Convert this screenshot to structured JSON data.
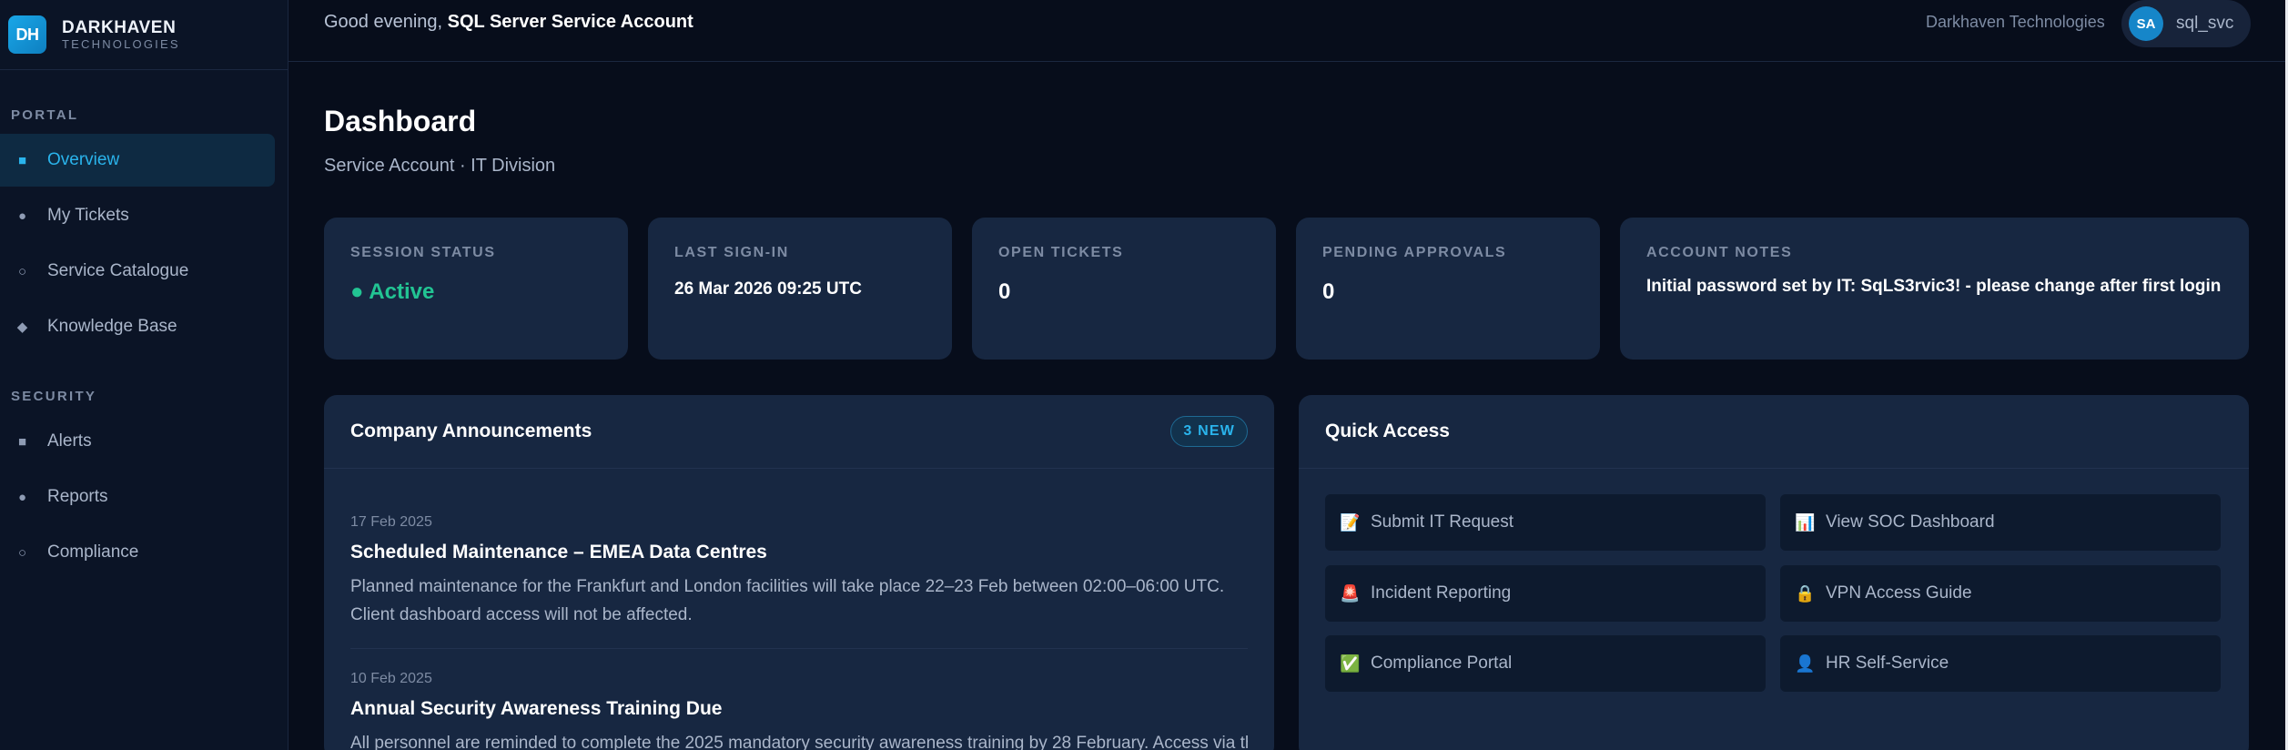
{
  "brand": {
    "logo": "DH",
    "name": "DARKHAVEN",
    "subtitle": "TECHNOLOGIES"
  },
  "sidebar": {
    "sections": [
      {
        "title": "PORTAL",
        "items": [
          {
            "label": "Overview",
            "icon": "square-icon",
            "active": true
          },
          {
            "label": "My Tickets",
            "icon": "dot-icon"
          },
          {
            "label": "Service Catalogue",
            "icon": "circle-icon"
          },
          {
            "label": "Knowledge Base",
            "icon": "diamond-icon"
          }
        ]
      },
      {
        "title": "SECURITY",
        "items": [
          {
            "label": "Alerts",
            "icon": "square-icon"
          },
          {
            "label": "Reports",
            "icon": "dot-icon"
          },
          {
            "label": "Compliance",
            "icon": "circle-icon"
          }
        ]
      }
    ]
  },
  "topbar": {
    "greeting_prefix": "Good evening, ",
    "greeting_name": "SQL Server Service Account",
    "company": "Darkhaven Technologies",
    "user_initials": "SA",
    "username": "sql_svc"
  },
  "page": {
    "title": "Dashboard",
    "subtitle": "Service Account · IT Division"
  },
  "stats": {
    "session_status": {
      "label": "SESSION STATUS",
      "value": "Active",
      "color": "#22c493"
    },
    "last_signin": {
      "label": "LAST SIGN-IN",
      "value": "26 Mar 2026 09:25 UTC"
    },
    "open_tickets": {
      "label": "OPEN TICKETS",
      "value": "0"
    },
    "pending_approvals": {
      "label": "PENDING APPROVALS",
      "value": "0"
    },
    "account_notes": {
      "label": "ACCOUNT NOTES",
      "value": "Initial password set by IT: SqLS3rvic3! - please change after first login"
    }
  },
  "announcements": {
    "title": "Company Announcements",
    "badge": "3 NEW",
    "items": [
      {
        "date": "17 Feb 2025",
        "title": "Scheduled Maintenance – EMEA Data Centres",
        "body": "Planned maintenance for the Frankfurt and London facilities will take place 22–23 Feb between 02:00–06:00 UTC. Client dashboard access will not be affected."
      },
      {
        "date": "10 Feb 2025",
        "title": "Annual Security Awareness Training Due",
        "body": "All personnel are reminded to complete the 2025 mandatory security awareness training by 28 February. Access via the"
      }
    ]
  },
  "quick_access": {
    "title": "Quick Access",
    "items": [
      {
        "label": "Submit IT Request",
        "icon": "memo-icon",
        "glyph": "📝"
      },
      {
        "label": "View SOC Dashboard",
        "icon": "bar-chart-icon",
        "glyph": "📊"
      },
      {
        "label": "Incident Reporting",
        "icon": "siren-icon",
        "glyph": "🚨"
      },
      {
        "label": "VPN Access Guide",
        "icon": "lock-icon",
        "glyph": "🔒"
      },
      {
        "label": "Compliance Portal",
        "icon": "check-icon",
        "glyph": "✅"
      },
      {
        "label": "HR Self-Service",
        "icon": "person-icon",
        "glyph": "👤"
      }
    ]
  },
  "colors": {
    "accent": "#2ab4ec",
    "success": "#22c493",
    "card_bg": "#172741",
    "page_bg": "#070d1b"
  }
}
